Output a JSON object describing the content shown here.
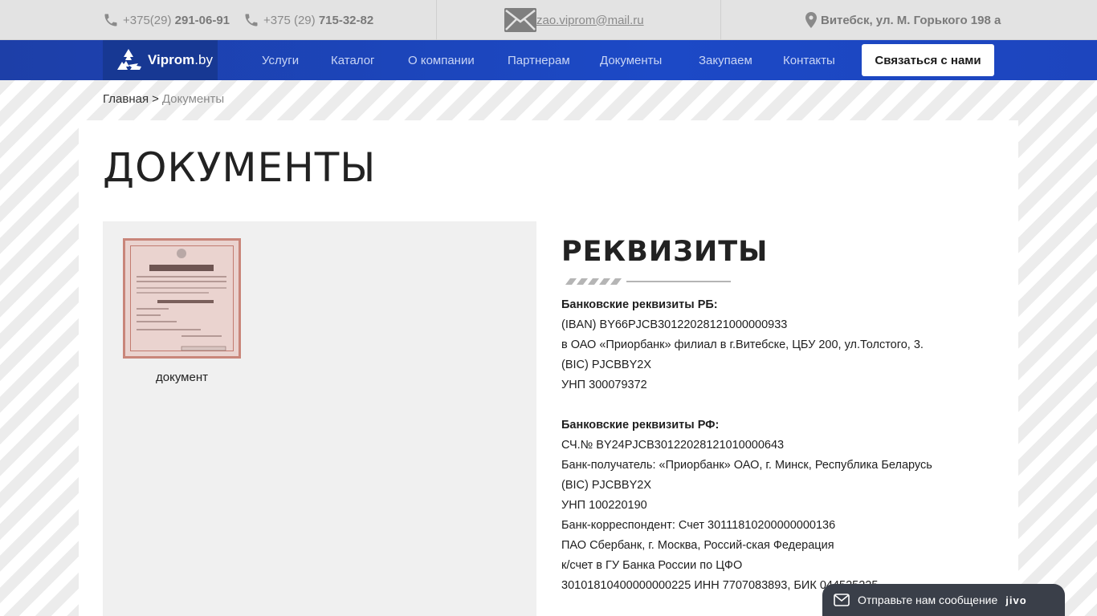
{
  "topbar": {
    "phone1_prefix": "+375(29)",
    "phone1_number": "291-06-91",
    "phone2_prefix": "+375 (29)",
    "phone2_number": "715-32-82",
    "email": "zao.viprom@mail.ru",
    "address": "Витебск, ул. М. Горького 198 а"
  },
  "nav": {
    "logo_bold": "Viprom",
    "logo_suffix": ".by",
    "items": [
      "Услуги",
      "Каталог",
      "О компании",
      "Партнерам",
      "Документы",
      "Закупаем",
      "Контакты"
    ],
    "cta": "Связаться с нами"
  },
  "breadcrumb": {
    "home": "Главная",
    "separator": ">",
    "current": "Документы"
  },
  "page": {
    "title": "ДОКУМЕНТЫ"
  },
  "documents": [
    {
      "caption": "документ"
    }
  ],
  "requisites": {
    "title": "РЕКВИЗИТЫ",
    "rb_heading": "Банковские реквизиты РБ:",
    "rb_lines": [
      "(IBAN) BY66PJCB30122028121000000933",
      "в ОАО «Приорбанк» филиал в г.Витебске, ЦБУ 200, ул.Толстого, 3.",
      "(BIC) PJCBBY2X",
      "УНП 300079372"
    ],
    "rf_heading": "Банковские реквизиты РФ:",
    "rf_lines": [
      "СЧ.№ BY24PJCB30122028121010000643",
      "Банк-получатель: «Приорбанк» ОАО, г. Минск, Республика Беларусь",
      "(BIC) PJCBBY2X",
      "УНП 100220190",
      "Банк-корреспондент: Счет 30111810200000000136",
      "ПАО Сбербанк, г. Москва, Россий-ская Федерация",
      "к/счет в ГУ Банка России по ЦФО",
      "30101810400000000225 ИНН 7707083893, БИК 044525225"
    ]
  },
  "chat": {
    "label": "Отправьте нам сообщение",
    "brand": "jivo"
  },
  "colors": {
    "nav_blue": "#1c49c6",
    "logo_bg": "#173893",
    "chat_bg": "#3a3f49"
  }
}
